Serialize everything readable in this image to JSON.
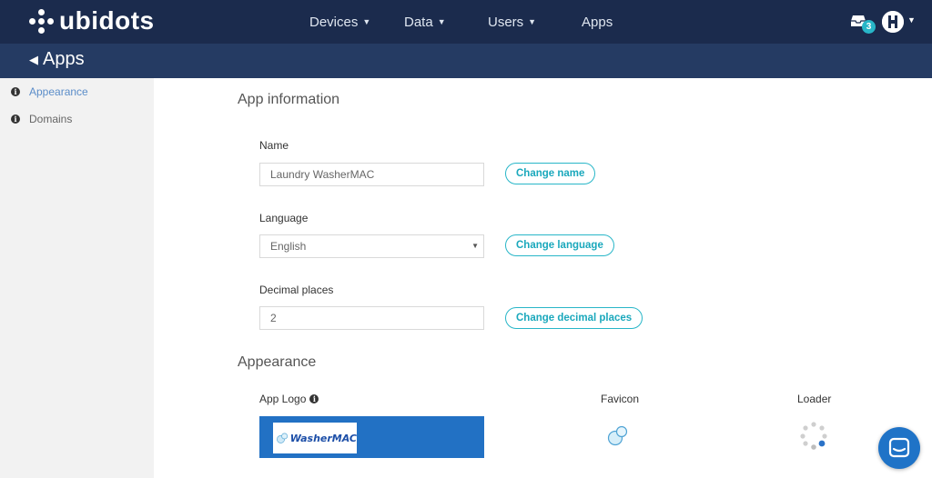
{
  "header": {
    "logo_text": "ubidots",
    "nav": [
      {
        "label": "Devices",
        "has_caret": true
      },
      {
        "label": "Data",
        "has_caret": true
      },
      {
        "label": "Users",
        "has_caret": true
      },
      {
        "label": "Apps",
        "has_caret": false
      }
    ],
    "notifications_count": "3",
    "colors": {
      "topbar": "#1b2b4d",
      "subbar": "#253b63",
      "accent": "#28b6c8"
    }
  },
  "subheader": {
    "back_label": "Apps"
  },
  "sidebar": {
    "items": [
      {
        "label": "Appearance",
        "active": true,
        "icon": "info-icon"
      },
      {
        "label": "Domains",
        "active": false,
        "icon": "info-icon"
      }
    ]
  },
  "main": {
    "app_info_title": "App information",
    "name": {
      "label": "Name",
      "value": "Laundry WasherMAC",
      "button": "Change name"
    },
    "language": {
      "label": "Language",
      "value": "English",
      "button": "Change language"
    },
    "decimal": {
      "label": "Decimal places",
      "value": "2",
      "button": "Change decimal places"
    },
    "appearance_title": "Appearance",
    "app_logo_label": "App Logo",
    "favicon_label": "Favicon",
    "loader_label": "Loader",
    "logo_brand_text": "WasherMAC"
  }
}
